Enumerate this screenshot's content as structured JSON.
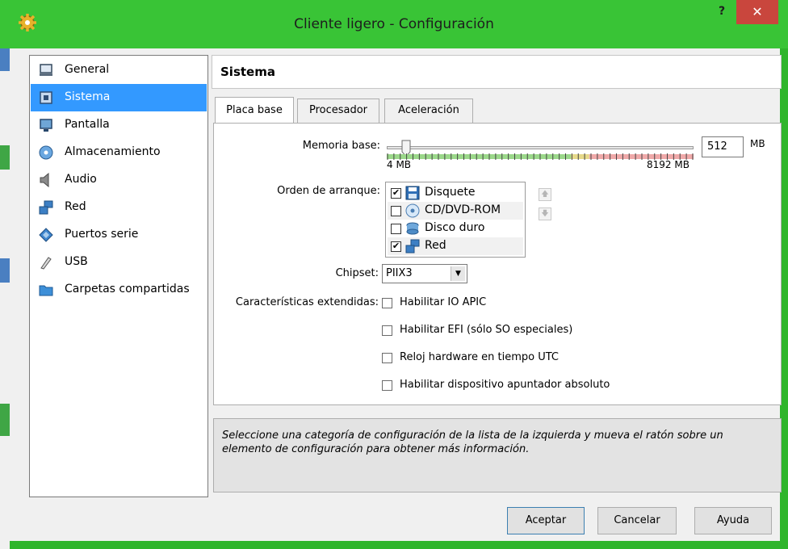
{
  "window": {
    "title": "Cliente ligero - Configuración",
    "help_label": "?",
    "close_label": "✕"
  },
  "sidebar": {
    "items": [
      {
        "label": "General",
        "icon": "monitor-icon"
      },
      {
        "label": "Sistema",
        "icon": "chip-icon",
        "selected": true
      },
      {
        "label": "Pantalla",
        "icon": "display-icon"
      },
      {
        "label": "Almacenamiento",
        "icon": "disc-icon"
      },
      {
        "label": "Audio",
        "icon": "speaker-icon"
      },
      {
        "label": "Red",
        "icon": "network-icon"
      },
      {
        "label": "Puertos serie",
        "icon": "serial-port-icon"
      },
      {
        "label": "USB",
        "icon": "usb-icon"
      },
      {
        "label": "Carpetas compartidas",
        "icon": "folder-icon"
      }
    ]
  },
  "header": {
    "title": "Sistema"
  },
  "tabs": [
    {
      "label": "Placa base",
      "active": true
    },
    {
      "label": "Procesador",
      "active": false
    },
    {
      "label": "Aceleración",
      "active": false
    }
  ],
  "motherboard": {
    "memory_label": "Memoria base:",
    "memory_value": "512",
    "memory_unit": "MB",
    "memory_min_label": "4 MB",
    "memory_max_label": "8192 MB",
    "memory_min": 4,
    "memory_max": 8192,
    "memory_current": 512,
    "boot_order_label": "Orden de arranque:",
    "boot_order": [
      {
        "label": "Disquete",
        "checked": true,
        "icon": "floppy-icon"
      },
      {
        "label": "CD/DVD-ROM",
        "checked": false,
        "icon": "cd-icon"
      },
      {
        "label": "Disco duro",
        "checked": false,
        "icon": "hard-disk-icon"
      },
      {
        "label": "Red",
        "checked": true,
        "icon": "network-icon"
      }
    ],
    "move_up_label": "🡅",
    "move_down_label": "🡇",
    "chipset_label": "Chipset:",
    "chipset_value": "PIIX3",
    "extended_label": "Características extendidas:",
    "extended_options": [
      {
        "label": "Habilitar IO APIC",
        "checked": false
      },
      {
        "label": "Habilitar EFI (sólo SO especiales)",
        "checked": false
      },
      {
        "label": "Reloj hardware en tiempo UTC",
        "checked": false
      },
      {
        "label": "Habilitar dispositivo apuntador absoluto",
        "checked": false
      }
    ]
  },
  "info": {
    "text": "Seleccione una categoría de configuración de la lista de la izquierda y mueva el ratón sobre un elemento de configuración para obtener más información."
  },
  "buttons": {
    "accept": "Aceptar",
    "cancel": "Cancelar",
    "help": "Ayuda"
  },
  "colors": {
    "titlebar": "#39c436",
    "selection": "#3399ff",
    "close": "#c9463d"
  }
}
